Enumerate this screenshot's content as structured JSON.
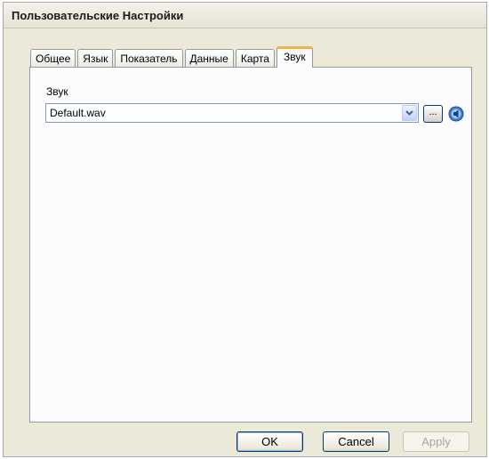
{
  "window": {
    "title": "Пользовательские Настройки"
  },
  "tabs": [
    {
      "label": "Общее",
      "active": false
    },
    {
      "label": "Язык",
      "active": false
    },
    {
      "label": "Показатель",
      "active": false
    },
    {
      "label": "Данные",
      "active": false
    },
    {
      "label": "Карта",
      "active": false
    },
    {
      "label": "Звук",
      "active": true
    }
  ],
  "sound": {
    "label": "Звук",
    "selected_value": "Default.wav",
    "browse_label": "..."
  },
  "buttons": {
    "ok": "OK",
    "cancel": "Cancel",
    "apply": "Apply"
  },
  "colors": {
    "active_tab_accent": "#f2b441",
    "dialog_bg": "#ece9d8"
  }
}
